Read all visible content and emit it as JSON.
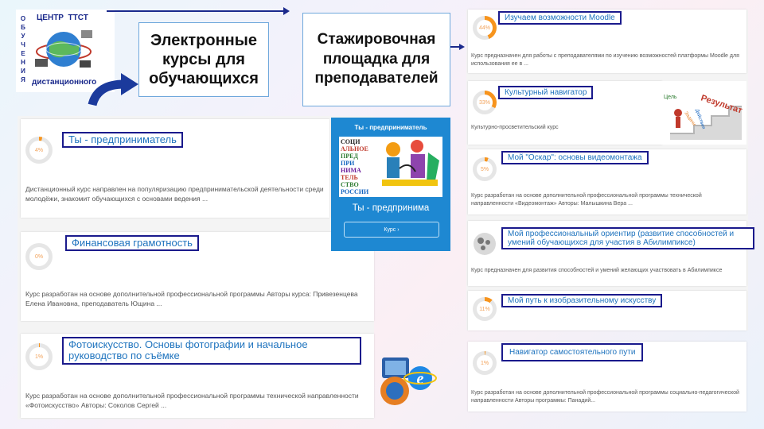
{
  "logo": {
    "vertical_letters": [
      "О",
      "Б",
      "У",
      "Ч",
      "Е",
      "Н",
      "И",
      "Я"
    ],
    "top_text": "ЦЕНТР  ТТСТ",
    "bottom_text": "дистанционного"
  },
  "headings": {
    "left": "Электронные курсы для обучающихся",
    "right": "Стажировочная площадка для преподавателей"
  },
  "left_courses": [
    {
      "title": "Ты - предприниматель",
      "progress": "4%",
      "progress_value": 4,
      "description": "Дистанционный курс направлен на популяризацию предпринимательской деятельности среди молодёжи, знакомит обучающихся с основами ведения ..."
    },
    {
      "title": "Финансовая грамотность",
      "progress": "0%",
      "progress_value": 0,
      "description": "Курс разработан на основе дополнительной профессиональной программы  Авторы курса: Привезенцева Елена Ивановна, преподаватель Ющина ..."
    },
    {
      "title": "Фотоискусство. Основы фотографии и начальное руководство по съёмке",
      "progress": "1%",
      "progress_value": 1,
      "description": "Курс разработан на основе дополнительной профессиональной программы технической направленности «Фотоискусство» Авторы: Соколов Сергей ..."
    }
  ],
  "promo": {
    "header": "Ты - предприниматель",
    "image_words": [
      "СОЦИ",
      "АЛЬНОЕ",
      "ПРЕД",
      "ПРИ",
      "НИМА",
      "ТЕЛЬ",
      "СТВО",
      "РОССИИ"
    ],
    "title": "Ты - предпринима",
    "button": "Курс ›"
  },
  "right_courses": [
    {
      "title": "Изучаем возможности Moodle",
      "progress": "44%",
      "progress_value": 44,
      "description": "Курс предназначен для работы с преподавателями по изучению возможностей  платформы Moodle для использования ее в ..."
    },
    {
      "title": "Культурный навигатор",
      "progress": "33%",
      "progress_value": 33,
      "description": "Культурно-просветительский курс"
    },
    {
      "title": "Мой \"Оскар\": основы видеомонтажа",
      "progress": "5%",
      "progress_value": 5,
      "description": "Курс разработан на основе дополнительной профессиональной программы технической направленности «Видеомонтаж» Авторы: Малышкина Вера ..."
    },
    {
      "title": "Мой профессиональный ориентир (развитие способностей и умений обучающихся для участия в Абилимпиксе)",
      "progress": "",
      "progress_value": null,
      "description": "Курс предназначен для развития способностей и умений  желающих участвовать в Абилимпиксе"
    },
    {
      "title": "Мой путь к изобразительному искусству",
      "progress": "11%",
      "progress_value": 11,
      "description": ""
    },
    {
      "title": "Навигатор самостоятельного пути",
      "progress": "1%",
      "progress_value": 1,
      "description": "Курс разработан  на основе  дополнительной профессиональной программы социально-педагогической направленности Авторы программы: Панадий..."
    }
  ],
  "goal_image": {
    "words": [
      "Цель",
      "Задачи",
      "Действия",
      "Результат"
    ]
  },
  "colors": {
    "accent": "#f7941d",
    "label_border": "#1a1a8c",
    "link": "#1e73be",
    "promo_bg": "#1e88d2"
  },
  "icons": [
    "arrow-right-icon",
    "curved-arrow-icon",
    "browser-icons",
    "gear-icon"
  ]
}
